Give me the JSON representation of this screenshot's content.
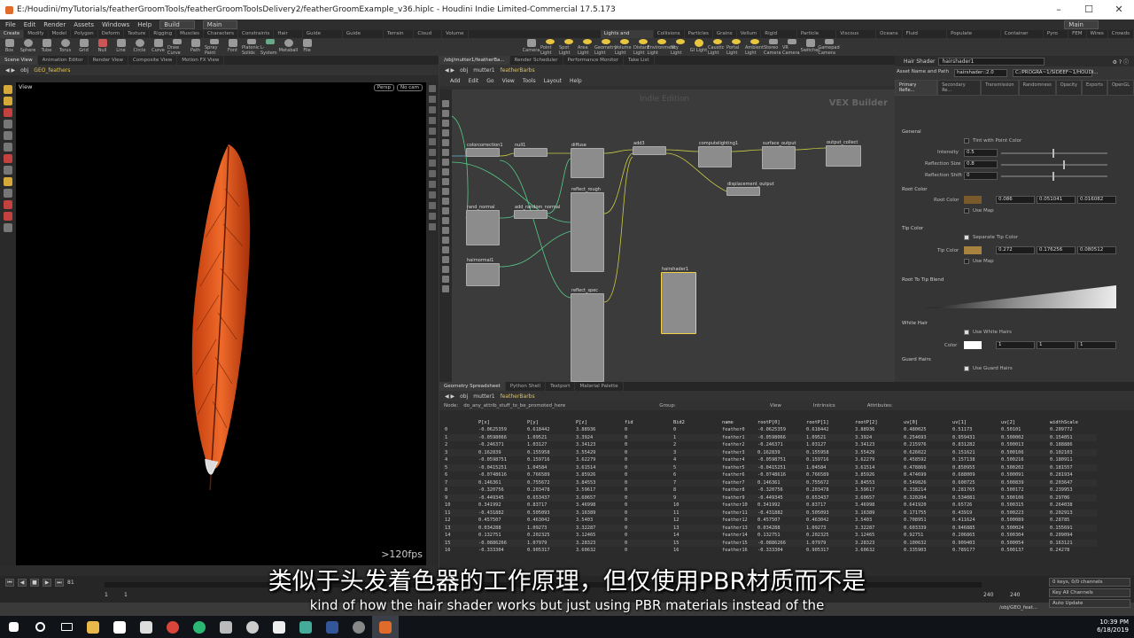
{
  "window": {
    "title": "E:/Houdini/myTutorials/featherGroomTools/featherGroomToolsDelivery2/featherGroomExample_v36.hiplc - Houdini Indie Limited-Commercial 17.5.173"
  },
  "menu": {
    "items": [
      "File",
      "Edit",
      "Render",
      "Assets",
      "Windows",
      "Help"
    ],
    "desktop": "Build",
    "desktop2": "Main",
    "right_desktop": "Main"
  },
  "shelf": {
    "left_tabs": [
      "Create",
      "Modify",
      "Model",
      "Polygon",
      "Deform",
      "Texture",
      "Rigging",
      "Muscles",
      "Characters",
      "Constraints",
      "Hair Utils",
      "Guide Process",
      "Guide Brushes",
      "Terrain FX",
      "Cloud FX",
      "Volume"
    ],
    "left_tools": [
      "Box",
      "Sphere",
      "Tube",
      "Torus",
      "Grid",
      "Null",
      "Line",
      "Circle",
      "Curve",
      "Draw Curve",
      "Path",
      "Spray Paint",
      "Font",
      "Platonic Solids",
      "L-System",
      "Metaball",
      "File"
    ],
    "right_tabs": [
      "Lights and Cameras",
      "Collisions",
      "Particles",
      "Grains",
      "Vellum",
      "Rigid Bodies",
      "Particle Fluids",
      "Viscous Fluids",
      "Oceans",
      "Fluid Containers",
      "Populate Containers",
      "Container Tools",
      "Pyro FX",
      "FEM",
      "Wires",
      "Crowds",
      "Drive Simulation",
      "Vsrr"
    ],
    "right_tools": [
      "Camera",
      "Point Light",
      "Spot Light",
      "Area Light",
      "Geometry Light",
      "Volume Light",
      "Distant Light",
      "Environment Light",
      "Sky Light",
      "GI Light",
      "Caustic Light",
      "Portal Light",
      "Ambient Light",
      "Stereo Camera",
      "VR Camera",
      "Switcher",
      "Gamepad Camera"
    ]
  },
  "left_pane": {
    "tabs": [
      "Scene View",
      "Animation Editor",
      "Render View",
      "Composite View",
      "Motion FX View"
    ],
    "path": [
      "obj",
      "GEO_feathers"
    ],
    "viewport_label": "View",
    "persp": "Persp",
    "cam": "No cam",
    "fps": ">120fps"
  },
  "node_pane": {
    "tabs": [
      "/obj/mutter1/featherBa...",
      "Render Scheduler",
      "Performance Monitor",
      "Take List"
    ],
    "path": [
      "obj",
      "mutter1",
      "featherBarbs"
    ],
    "menu": [
      "Add",
      "Edit",
      "Go",
      "View",
      "Tools",
      "Layout",
      "Help"
    ],
    "watermark": "Indie Edition",
    "context": "VEX Builder",
    "nodes": [
      "colorcorrection1",
      "null1",
      "diffuse",
      "add3",
      "computelighting1",
      "surface_output",
      "output_collect",
      "reflect_rough",
      "displacement_output",
      "rand_normal",
      "add_random_normal",
      "hairnormal1",
      "reflect_spec",
      "hairshader1"
    ]
  },
  "params": {
    "type": "Hair Shader",
    "name": "hairshader1",
    "asset_label": "Asset Name and Path",
    "asset_name": "hairshader::2.0",
    "asset_path": "C:/PROGRA~1/SIDEEF~1/HOUDI...",
    "tabs": [
      "Primary Refle...",
      "Secondary Re...",
      "Transmission",
      "Randomness",
      "Opacity",
      "Exports",
      "OpenGL"
    ],
    "general": "General",
    "tint": "Tint with Point Color",
    "intensity_label": "Intensity",
    "intensity": "0.5",
    "refl_size_label": "Reflection Size",
    "refl_size": "0.8",
    "refl_shift_label": "Reflection Shift",
    "refl_shift": "0",
    "root_color_section": "Root Color",
    "root_color_label": "Root Color",
    "root_r": "0.086",
    "root_g": "0.051041",
    "root_b": "0.016082",
    "use_map": "Use Map",
    "tip_color_section": "Tip Color",
    "separate_tip": "Separate Tip Color",
    "tip_color_label": "Tip Color",
    "tip_r": "0.272",
    "tip_g": "0.176256",
    "tip_b": "0.080512",
    "blend_section": "Root To Tip Blend",
    "white_hair_section": "White Hair",
    "use_white": "Use White Hairs",
    "color_label": "Color",
    "white_r": "1",
    "white_g": "1",
    "white_b": "1",
    "guard_section": "Guard Hairs",
    "use_guard": "Use Guard Hairs",
    "root_swatch": "#7a5a2a",
    "tip_swatch": "#a8823f"
  },
  "spreadsheet": {
    "tabs": [
      "Geometry Spreadsheet",
      "Python Shell",
      "Textport",
      "Material Palette"
    ],
    "path": [
      "obj",
      "mutter1",
      "featherBarbs"
    ],
    "node_label": "Node:",
    "node_value": "do_any_attrib_stuff_to_be_promoted_here",
    "group_label": "Group:",
    "view_label": "View",
    "intrinsics": "Intrinsics",
    "attributes": "Attributes:",
    "columns": [
      "",
      "P[x]",
      "P[y]",
      "P[z]",
      "fid",
      "Bid2",
      "name",
      "rootP[0]",
      "rootP[1]",
      "rootP[2]",
      "uv[0]",
      "uv[1]",
      "uv[2]",
      "widthScale"
    ],
    "rows": [
      [
        "0",
        "-0.0625359",
        "0.618442",
        "3.88936",
        "0",
        "0",
        "feather0",
        "-0.0625359",
        "0.618442",
        "3.88936",
        "0.480025",
        "0.51173",
        "0.50101",
        "0.209772"
      ],
      [
        "1",
        "-0.0598066",
        "1.09521",
        "3.3924",
        "0",
        "1",
        "feather1",
        "-0.0598066",
        "1.09521",
        "3.3924",
        "0.254693",
        "0.959431",
        "0.500002",
        "0.154051"
      ],
      [
        "2",
        "-0.246371",
        "1.03127",
        "3.34123",
        "0",
        "2",
        "feather2",
        "-0.246371",
        "1.03127",
        "3.34123",
        "0.215976",
        "0.831282",
        "0.500013",
        "0.188886"
      ],
      [
        "3",
        "0.162839",
        "0.155958",
        "3.55429",
        "0",
        "3",
        "feather3",
        "0.162839",
        "0.155958",
        "3.55429",
        "0.626022",
        "0.151621",
        "0.500106",
        "0.102103"
      ],
      [
        "4",
        "-0.0598751",
        "0.159716",
        "3.62279",
        "0",
        "4",
        "feather4",
        "-0.0598751",
        "0.159716",
        "3.62279",
        "0.458592",
        "0.157138",
        "0.500216",
        "0.180911"
      ],
      [
        "5",
        "-0.0415251",
        "1.04584",
        "3.61514",
        "0",
        "5",
        "feather5",
        "-0.0415251",
        "1.04584",
        "3.61514",
        "0.478866",
        "0.850955",
        "0.500202",
        "0.181557"
      ],
      [
        "6",
        "-0.0748616",
        "0.766589",
        "3.85926",
        "0",
        "6",
        "feather6",
        "-0.0748616",
        "0.766589",
        "3.85926",
        "0.474699",
        "0.688009",
        "0.500091",
        "0.281934"
      ],
      [
        "7",
        "0.146361",
        "0.755672",
        "3.84553",
        "0",
        "7",
        "feather7",
        "0.146361",
        "0.755672",
        "3.84553",
        "0.549826",
        "0.600725",
        "0.500839",
        "0.203647"
      ],
      [
        "8",
        "-0.320756",
        "0.203478",
        "3.59617",
        "0",
        "8",
        "feather8",
        "-0.320756",
        "0.203478",
        "3.59617",
        "0.338214",
        "0.281765",
        "0.500172",
        "0.239953"
      ],
      [
        "9",
        "-0.449345",
        "0.653437",
        "3.60657",
        "0",
        "9",
        "feather9",
        "-0.449345",
        "0.653437",
        "3.60657",
        "0.320204",
        "0.534081",
        "0.500106",
        "0.29706"
      ],
      [
        "10",
        "0.341992",
        "0.83717",
        "3.46998",
        "0",
        "10",
        "feather10",
        "0.341992",
        "0.83717",
        "3.46998",
        "0.641920",
        "0.65726",
        "0.500315",
        "0.264038"
      ],
      [
        "11",
        "-0.431882",
        "0.505093",
        "3.16389",
        "0",
        "11",
        "feather11",
        "-0.431882",
        "0.505093",
        "3.16389",
        "0.171755",
        "0.43919",
        "0.500223",
        "0.202913"
      ],
      [
        "12",
        "0.457507",
        "0.463042",
        "3.5403",
        "0",
        "12",
        "feather12",
        "0.457507",
        "0.463042",
        "3.5403",
        "0.708951",
        "0.411624",
        "0.500089",
        "0.28785"
      ],
      [
        "13",
        "0.034288",
        "1.09273",
        "3.32287",
        "0",
        "13",
        "feather13",
        "0.034288",
        "1.09273",
        "3.32287",
        "0.603339",
        "0.946885",
        "0.500024",
        "0.155691"
      ],
      [
        "14",
        "0.132751",
        "0.202325",
        "3.12465",
        "0",
        "14",
        "feather14",
        "0.132751",
        "0.202325",
        "3.12465",
        "0.92751",
        "0.206865",
        "0.500304",
        "0.209094"
      ],
      [
        "15",
        "-0.0886266",
        "1.07979",
        "3.28323",
        "0",
        "15",
        "feather15",
        "-0.0886266",
        "1.07979",
        "3.28323",
        "0.100632",
        "0.909403",
        "0.500054",
        "0.163121"
      ],
      [
        "16",
        "-0.333304",
        "0.905317",
        "3.60632",
        "0",
        "16",
        "feather16",
        "-0.333304",
        "0.905317",
        "3.60632",
        "0.335903",
        "0.789177",
        "0.500137",
        "0.24278"
      ]
    ]
  },
  "timeline": {
    "frame": "81",
    "start": "1",
    "start2": "1",
    "end": "240",
    "end2": "240",
    "keys": "0 keys, 0/0 channels",
    "key_all": "Key All Channels",
    "auto_update": "Auto Update",
    "status_path": "/obj/GEO_feat..."
  },
  "subtitles": {
    "cn": "类似于头发着色器的工作原理，但仅使用PBR材质而不是",
    "en": "kind of how the hair shader works but just using PBR materials instead of the"
  },
  "taskbar": {
    "time": "10:39 PM",
    "date": "6/18/2019"
  }
}
